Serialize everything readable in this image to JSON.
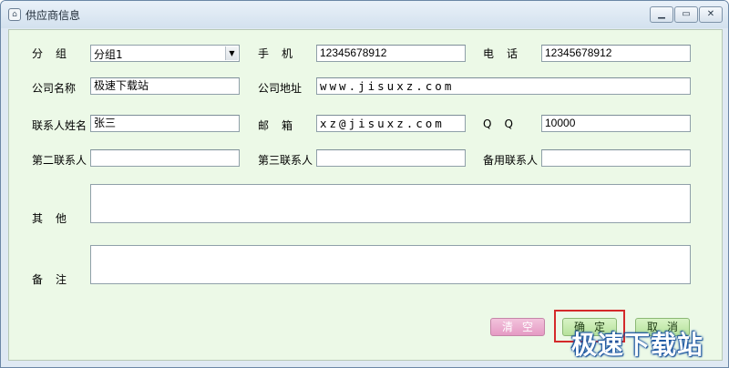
{
  "window": {
    "title": "供应商信息",
    "controls": {
      "minimize": "▁",
      "maximize": "▭",
      "close": "✕"
    }
  },
  "form": {
    "group": {
      "label": "分组",
      "value": "分组1"
    },
    "mobile": {
      "label": "手机",
      "value": "12345678912"
    },
    "phone": {
      "label": "电话",
      "value": "12345678912"
    },
    "company_name": {
      "label": "公司名称",
      "value": "极速下载站"
    },
    "company_address": {
      "label": "公司地址",
      "value": "www.jisuxz.com"
    },
    "contact_name": {
      "label": "联系人姓名",
      "value": "张三"
    },
    "email": {
      "label": "邮箱",
      "value": "xz@jisuxz.com"
    },
    "qq": {
      "label": "QQ",
      "value": "10000"
    },
    "second_contact": {
      "label": "第二联系人",
      "value": ""
    },
    "third_contact": {
      "label": "第三联系人",
      "value": ""
    },
    "backup_contact": {
      "label": "备用联系人",
      "value": ""
    },
    "other": {
      "label": "其他",
      "value": ""
    },
    "remarks": {
      "label": "备注",
      "value": ""
    }
  },
  "buttons": {
    "clear": "清空",
    "confirm": "确定",
    "cancel": "取消"
  },
  "watermark": "极速下载站"
}
